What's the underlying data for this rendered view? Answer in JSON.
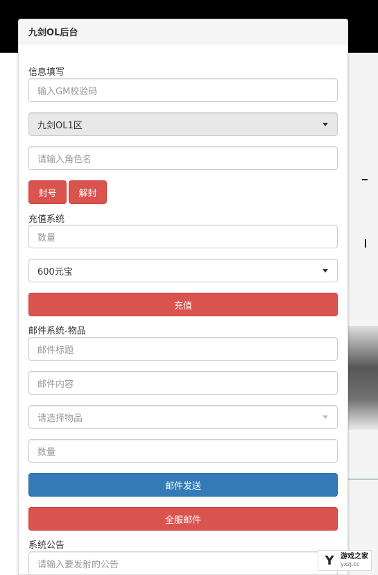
{
  "panel": {
    "title": "九剑OL后台"
  },
  "info": {
    "label": "信息填写",
    "gm_code_placeholder": "输入GM校验码",
    "server_selected": "九剑OL1区",
    "role_placeholder": "请输入角色名",
    "ban_label": "封号",
    "unban_label": "解封"
  },
  "recharge": {
    "label": "充值系统",
    "amount_placeholder": "数量",
    "package_selected": "600元宝",
    "submit_label": "充值"
  },
  "mail": {
    "label": "邮件系统-物品",
    "title_placeholder": "邮件标题",
    "content_placeholder": "邮件内容",
    "item_placeholder": "请选择物品",
    "amount_placeholder": "数量",
    "send_label": "邮件发送",
    "send_all_label": "全服邮件"
  },
  "notice": {
    "label": "系统公告",
    "input_placeholder": "请输入要发射的公告"
  },
  "watermark": {
    "mark": "Y",
    "title": "游戏之家",
    "url": "yxzj.cc"
  },
  "colors": {
    "danger": "#d9534f",
    "primary": "#337ab7"
  }
}
